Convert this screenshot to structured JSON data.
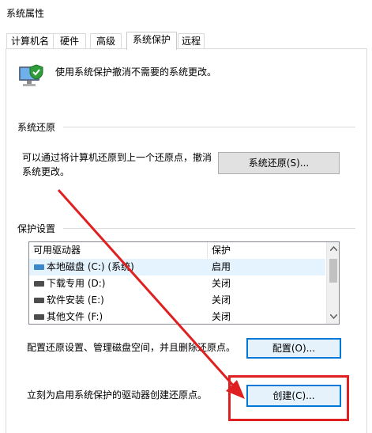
{
  "window": {
    "title": "系统属性"
  },
  "tabs": [
    "计算机名",
    "硬件",
    "高级",
    "系统保护",
    "远程"
  ],
  "intro": {
    "text": "使用系统保护撤消不需要的系统更改。",
    "icon": "shield-computer-icon"
  },
  "restore": {
    "group_label": "系统还原",
    "desc_line1": "可以通过将计算机还原到上一个还原点，撤消",
    "desc_line2": "系统更改。",
    "button_label": "系统还原(S)..."
  },
  "protection": {
    "group_label": "保护设置",
    "columns": {
      "drive": "可用驱动器",
      "protect": "保护"
    },
    "rows": [
      {
        "drive": "本地磁盘 (C:) (系统)",
        "protect": "启用"
      },
      {
        "drive": "下载专用 (D:)",
        "protect": "关闭"
      },
      {
        "drive": "软件安装 (E:)",
        "protect": "关闭"
      },
      {
        "drive": "其他文件 (F:)",
        "protect": "关闭"
      }
    ],
    "configure_text": "配置还原设置、管理磁盘空间，并且删除还原点。",
    "configure_button": "配置(O)...",
    "create_text": "立刻为启用系统保护的驱动器创建还原点。",
    "create_button": "创建(C)..."
  },
  "annotation": {
    "color": "#e02020"
  }
}
